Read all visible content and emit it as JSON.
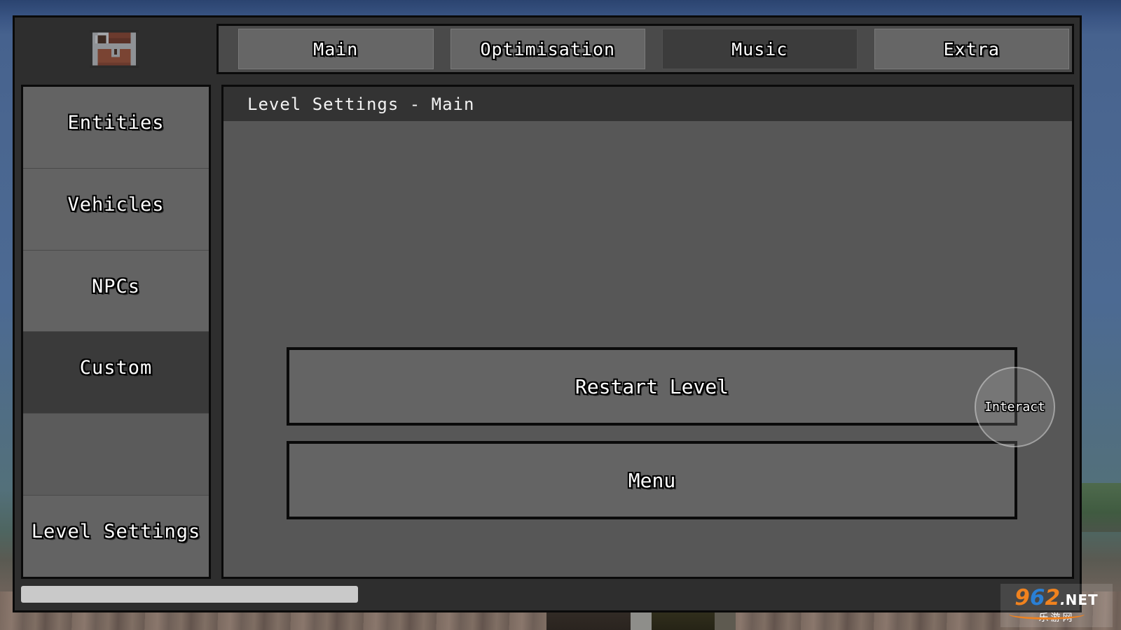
{
  "app": {
    "logo_icon": "treasure-chest-icon"
  },
  "tabs": [
    {
      "label": "Main",
      "active": false
    },
    {
      "label": "Optimisation",
      "active": false
    },
    {
      "label": "Music",
      "active": true
    },
    {
      "label": "Extra",
      "active": false
    }
  ],
  "sidebar": {
    "items": [
      {
        "label": "Entities",
        "active": false,
        "blank": false
      },
      {
        "label": "Vehicles",
        "active": false,
        "blank": false
      },
      {
        "label": "NPCs",
        "active": false,
        "blank": false
      },
      {
        "label": "Custom",
        "active": true,
        "blank": false
      },
      {
        "label": "",
        "active": false,
        "blank": true
      },
      {
        "label": "Level Settings",
        "active": false,
        "blank": false
      }
    ]
  },
  "content": {
    "header_title": "Level Settings - Main",
    "buttons": [
      {
        "label": "Restart Level"
      },
      {
        "label": "Menu"
      }
    ]
  },
  "overlay": {
    "interact_label": "Interact"
  },
  "scrollbar": {
    "thumb_percent": "32"
  },
  "watermark": {
    "digit1": "9",
    "digit2": "6",
    "digit3": "2",
    "dot": ".",
    "net": "NET",
    "subtitle": "乐游网"
  },
  "colors": {
    "panel_bg": "#2e2e2e",
    "content_bg": "#575757",
    "header_bg": "#333333",
    "tab_bg": "#666666",
    "tab_active_bg": "#3c3c3c",
    "side_item_bg": "#636363",
    "side_item_active_bg": "#3a3a3a",
    "button_bg": "#646464",
    "border": "#0a0a0a",
    "scroll_thumb": "#c9c9c9",
    "accent_orange": "#f0821e",
    "accent_blue": "#2a7fd4"
  }
}
